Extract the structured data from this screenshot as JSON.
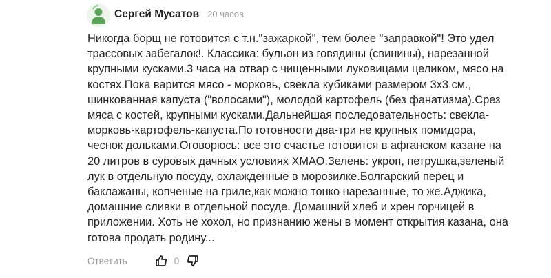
{
  "comment": {
    "author": "Сергей Мусатов",
    "time": "20 часов",
    "avatar_icon": "user-avatar-icon",
    "text": "Никогда борщ не готовится с т.н.\"зажаркой\", тем более \"заправкой\"! Это удел\nтрассовых забегалок!. Классика: бульон из говядины (свинины), нарезанной\nкрупными кусками.3 часа на отвар с чищенными луковицами целиком, мясо на\nкостях.Пока варится мясо - морковь, свекла кубиками размером 3х3 см.,\nшинкованная капуста (\"волосами\"), молодой картофель (без фанатизма).Срез\nмяса с костей, крупными кусками.Дальнейшая последовательность: свекла-\nморковь-картофель-капуста.По готовности два-три не крупных помидора,\nчеснок дольками.Оговорюсь: все это счастье готовится в афганском казане на\n20 литров в суровых дачных условиях ХМАО.Зелень: укроп, петрушка,зеленый\nлук в отдельную посуду, охлажденные в морозилке.Болгарский перец и\nбаклажаны, копченые на гриле,как можно тонко нарезанные, то же.Аджика,\nдомашние сливки в отдельной посуде. Домашний хлеб и хрен горчицей в\nприложении. Хоть не хохол, но признанию жены в момент открытия казана, она\nготова продать родину...",
    "actions": {
      "reply_label": "Ответить",
      "like_icon": "thumbs-up-icon",
      "score": "0",
      "dislike_icon": "thumbs-down-icon"
    }
  },
  "colors": {
    "avatar_bg": "#eef5ec",
    "avatar_fg": "#5aa35a",
    "text": "#262626",
    "muted": "#9a9a9a"
  }
}
